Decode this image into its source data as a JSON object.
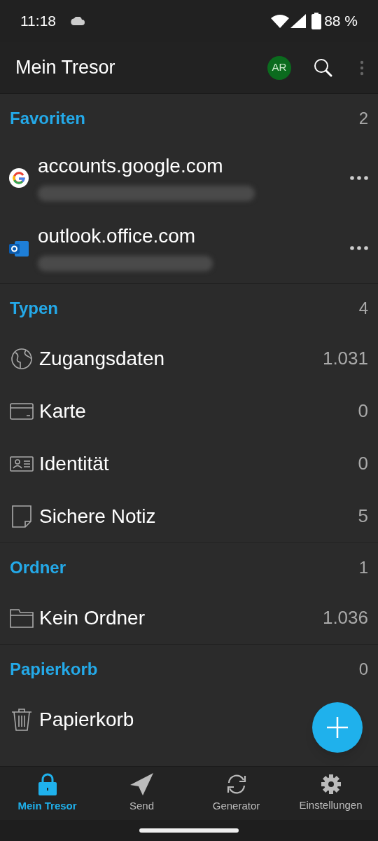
{
  "status_bar": {
    "time": "11:18",
    "battery": "88 %"
  },
  "app_bar": {
    "title": "Mein Tresor",
    "avatar": "AR"
  },
  "sections": [
    {
      "title": "Favoriten",
      "count": "2",
      "items": [
        {
          "kind": "google",
          "title": "accounts.google.com"
        },
        {
          "kind": "outlook",
          "title": "outlook.office.com"
        }
      ]
    },
    {
      "title": "Typen",
      "count": "4",
      "items": [
        {
          "kind": "globe",
          "title": "Zugangsdaten",
          "count": "1.031"
        },
        {
          "kind": "card",
          "title": "Karte",
          "count": "0"
        },
        {
          "kind": "identity",
          "title": "Identität",
          "count": "0"
        },
        {
          "kind": "note",
          "title": "Sichere Notiz",
          "count": "5"
        }
      ]
    },
    {
      "title": "Ordner",
      "count": "1",
      "items": [
        {
          "kind": "folder",
          "title": "Kein Ordner",
          "count": "1.036"
        }
      ]
    },
    {
      "title": "Papierkorb",
      "count": "0",
      "items": [
        {
          "kind": "trash",
          "title": "Papierkorb"
        }
      ]
    }
  ],
  "bottom_nav": [
    {
      "kind": "lock",
      "label": "Mein Tresor",
      "selected": true
    },
    {
      "kind": "send",
      "label": "Send",
      "selected": false
    },
    {
      "kind": "sync",
      "label": "Generator",
      "selected": false
    },
    {
      "kind": "gear",
      "label": "Einstellungen",
      "selected": false
    }
  ]
}
